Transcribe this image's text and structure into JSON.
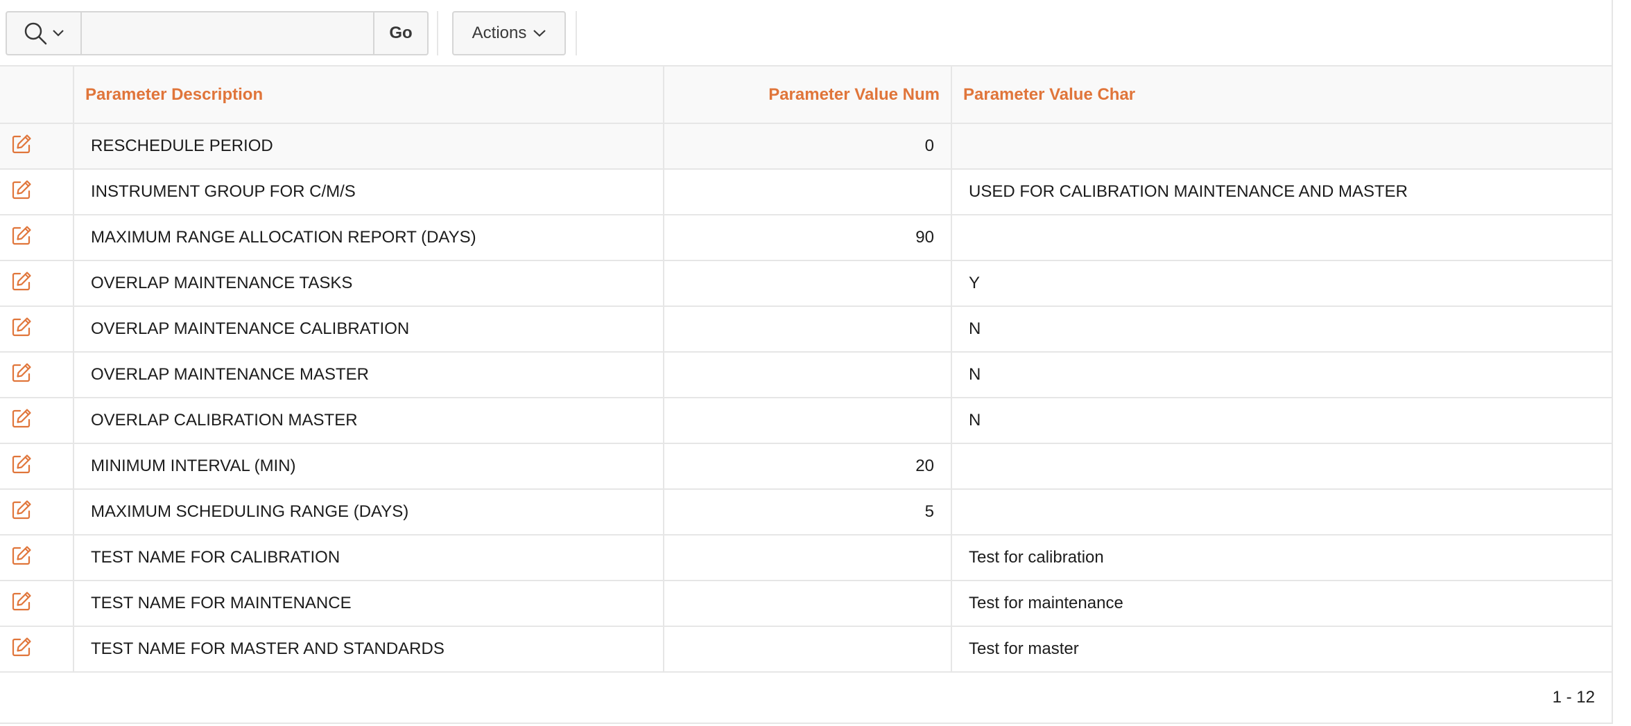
{
  "toolbar": {
    "search_icon": "search-icon",
    "search_placeholder": "",
    "go_label": "Go",
    "actions_label": "Actions"
  },
  "table": {
    "columns": [
      "Parameter Description",
      "Parameter Value Num",
      "Parameter Value Char"
    ],
    "rows": [
      {
        "desc": "RESCHEDULE PERIOD",
        "num": "0",
        "char": ""
      },
      {
        "desc": "INSTRUMENT GROUP FOR C/M/S",
        "num": "",
        "char": "USED FOR CALIBRATION MAINTENANCE AND MASTER"
      },
      {
        "desc": "MAXIMUM RANGE ALLOCATION REPORT (DAYS)",
        "num": "90",
        "char": ""
      },
      {
        "desc": "OVERLAP MAINTENANCE TASKS",
        "num": "",
        "char": "Y"
      },
      {
        "desc": "OVERLAP MAINTENANCE CALIBRATION",
        "num": "",
        "char": "N"
      },
      {
        "desc": "OVERLAP MAINTENANCE MASTER",
        "num": "",
        "char": "N"
      },
      {
        "desc": "OVERLAP CALIBRATION MASTER",
        "num": "",
        "char": "N"
      },
      {
        "desc": "MINIMUM INTERVAL (MIN)",
        "num": "20",
        "char": ""
      },
      {
        "desc": "MAXIMUM SCHEDULING RANGE (DAYS)",
        "num": "5",
        "char": ""
      },
      {
        "desc": "TEST NAME FOR CALIBRATION",
        "num": "",
        "char": "Test for calibration"
      },
      {
        "desc": "TEST NAME FOR MAINTENANCE",
        "num": "",
        "char": "Test for maintenance"
      },
      {
        "desc": "TEST NAME FOR MASTER AND STANDARDS",
        "num": "",
        "char": "Test for master"
      }
    ]
  },
  "pagination": "1 - 12",
  "colors": {
    "accent": "#e0753a",
    "border": "#e6e6e6",
    "header_bg": "#f9f9f9"
  }
}
